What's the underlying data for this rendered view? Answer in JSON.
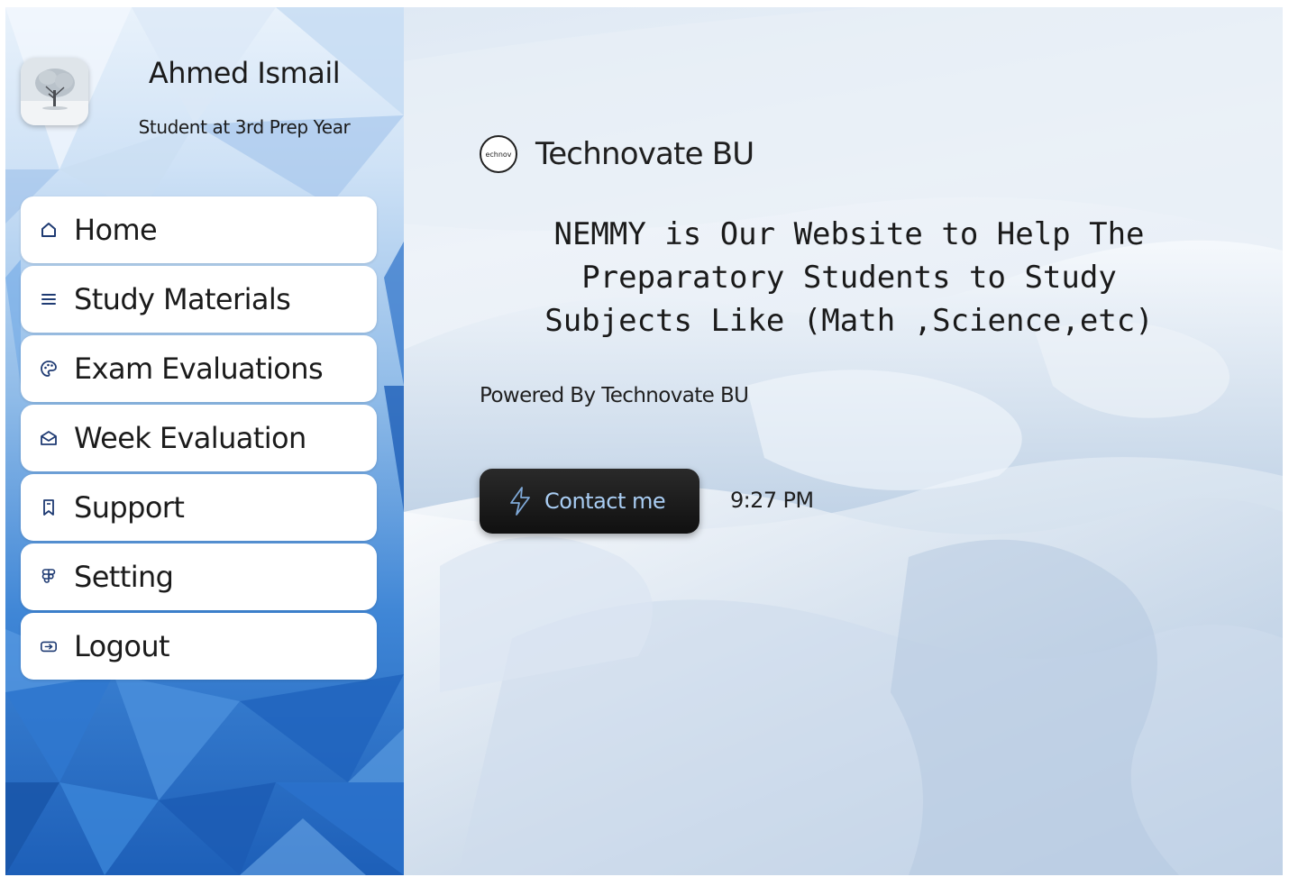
{
  "profile": {
    "name": "Ahmed Ismail",
    "role": "Student at 3rd Prep Year"
  },
  "menu": {
    "items": [
      {
        "label": "Home",
        "icon": "home-icon"
      },
      {
        "label": "Study Materials",
        "icon": "menu-lines-icon"
      },
      {
        "label": "Exam Evaluations",
        "icon": "palette-icon"
      },
      {
        "label": "Week Evaluation",
        "icon": "open-mail-icon"
      },
      {
        "label": "Support",
        "icon": "bookmark-icon"
      },
      {
        "label": "Setting",
        "icon": "figma-icon"
      },
      {
        "label": "Logout",
        "icon": "logout-icon"
      }
    ]
  },
  "hero": {
    "brand_name": "Technovate BU",
    "brand_logo_text": "echnov",
    "headline": "NEMMY is Our Website to Help The\nPreparatory Students to Study\nSubjects Like (Math ,Science,etc)",
    "powered_by": "Powered By Technovate BU",
    "contact_label": "Contact me",
    "time": "9:27 PM"
  },
  "colors": {
    "sidebar_blue": "#3f86d6",
    "contact_bg": "#151515",
    "contact_text": "#a9cdf3"
  }
}
